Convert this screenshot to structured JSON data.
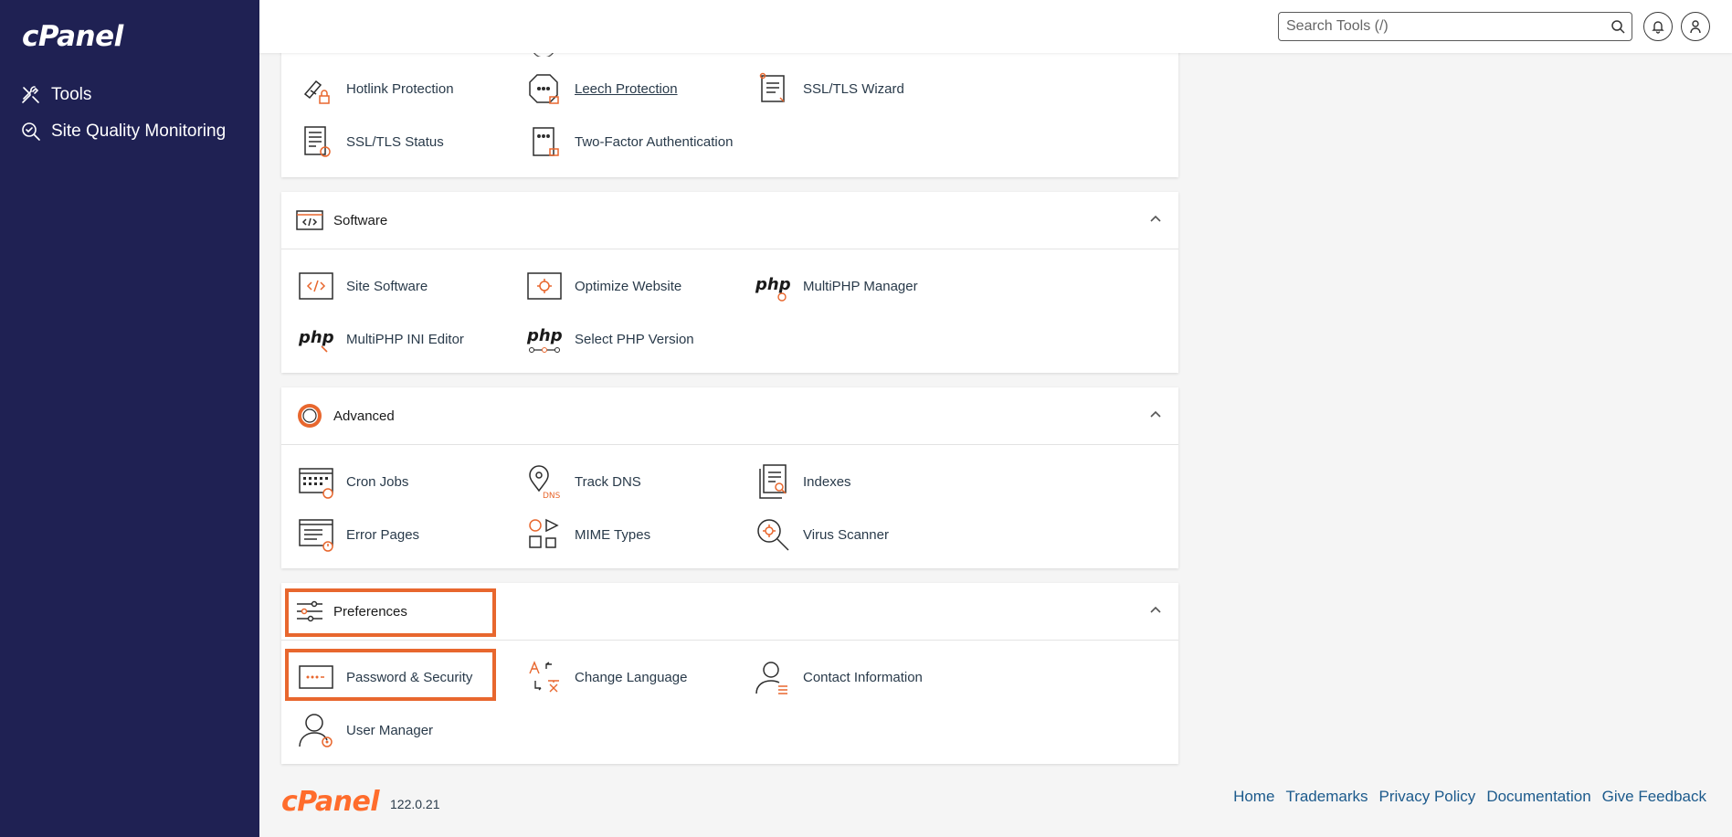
{
  "brand": {
    "name": "cPanel",
    "accent": "#ff6c2c",
    "sidebar_bg": "#1f2153"
  },
  "sidebar": {
    "items": [
      {
        "label": "Tools",
        "icon": "tools-icon"
      },
      {
        "label": "Site Quality Monitoring",
        "icon": "site-quality-icon"
      }
    ]
  },
  "topbar": {
    "search_placeholder": "Search Tools (/)"
  },
  "security": {
    "items": [
      {
        "label": "Hotlink Protection",
        "icon": "hotlink-icon"
      },
      {
        "label": "Leech Protection",
        "icon": "leech-icon"
      },
      {
        "label": "SSL/TLS Wizard",
        "icon": "ssl-wizard-icon"
      },
      {
        "label": "SSL/TLS Status",
        "icon": "ssl-status-icon"
      },
      {
        "label": "Two-Factor Authentication",
        "icon": "two-factor-icon"
      }
    ]
  },
  "software": {
    "title": "Software",
    "items": [
      {
        "label": "Site Software",
        "icon": "site-software-icon"
      },
      {
        "label": "Optimize Website",
        "icon": "optimize-icon"
      },
      {
        "label": "MultiPHP Manager",
        "icon": "php-icon"
      },
      {
        "label": "MultiPHP INI Editor",
        "icon": "php-ini-icon"
      },
      {
        "label": "Select PHP Version",
        "icon": "php-version-icon"
      }
    ]
  },
  "advanced": {
    "title": "Advanced",
    "items": [
      {
        "label": "Cron Jobs",
        "icon": "cron-icon"
      },
      {
        "label": "Track DNS",
        "icon": "track-dns-icon"
      },
      {
        "label": "Indexes",
        "icon": "indexes-icon"
      },
      {
        "label": "Error Pages",
        "icon": "error-pages-icon"
      },
      {
        "label": "MIME Types",
        "icon": "mime-icon"
      },
      {
        "label": "Virus Scanner",
        "icon": "virus-scanner-icon"
      }
    ]
  },
  "preferences": {
    "title": "Preferences",
    "items": [
      {
        "label": "Password & Security",
        "icon": "password-icon"
      },
      {
        "label": "Change Language",
        "icon": "language-icon"
      },
      {
        "label": "Contact Information",
        "icon": "contact-icon"
      },
      {
        "label": "User Manager",
        "icon": "user-manager-icon"
      }
    ]
  },
  "footer": {
    "logo": "cPanel",
    "version": "122.0.21",
    "links": [
      "Home",
      "Trademarks",
      "Privacy Policy",
      "Documentation",
      "Give Feedback"
    ]
  }
}
